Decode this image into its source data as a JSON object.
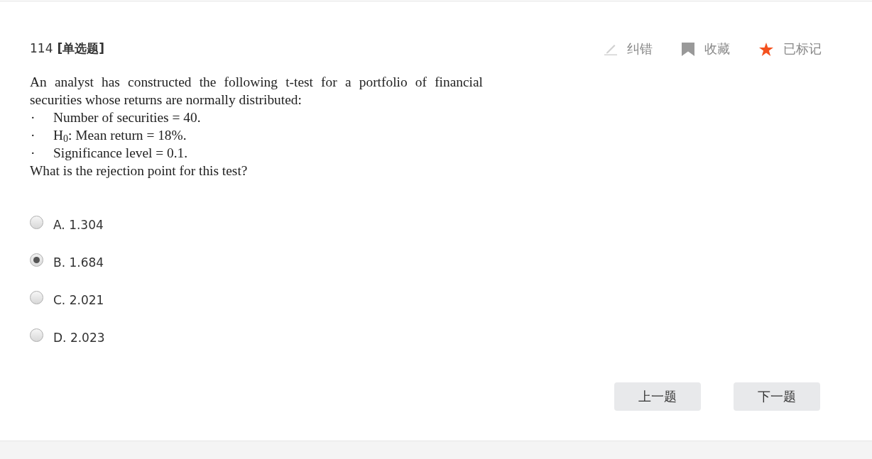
{
  "question": {
    "number": "114",
    "type": "[单选题]",
    "intro": "An analyst has constructed the following t-test for a portfolio of financial securities whose returns are normally distributed:",
    "bullets": [
      {
        "marker": "·",
        "text": "Number of securities = 40."
      },
      {
        "marker": "·",
        "text": "H$_{0}$: Mean return = 18%."
      },
      {
        "marker": "·",
        "text": "Significance level = 0.1."
      }
    ],
    "prompt": "What is the rejection point for this test?"
  },
  "actions": [
    {
      "kind": "edit",
      "label": "纠错",
      "on": false
    },
    {
      "kind": "bookmark",
      "label": "收藏",
      "on": false
    },
    {
      "kind": "star",
      "label": "已标记",
      "on": true
    }
  ],
  "options": [
    {
      "label": "A. 1.304",
      "selected": false
    },
    {
      "label": "B. 1.684",
      "selected": true
    },
    {
      "label": "C. 2.021",
      "selected": false
    },
    {
      "label": "D. 2.023",
      "selected": false
    }
  ],
  "buttons": [
    "上一题",
    "下一题"
  ]
}
